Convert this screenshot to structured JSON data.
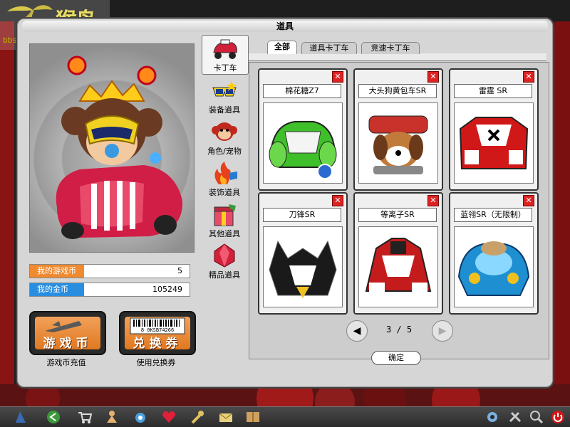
{
  "watermark": {
    "logo_text": "猴岛",
    "url": "bbs.houdao.com"
  },
  "window": {
    "title": "道具"
  },
  "categories": [
    {
      "label": "卡丁车",
      "icon": "kart-icon",
      "selected": true
    },
    {
      "label": "装备道具",
      "icon": "goggles-icon"
    },
    {
      "label": "角色/宠物",
      "icon": "monkey-icon"
    },
    {
      "label": "装饰道具",
      "icon": "flame-decor-icon"
    },
    {
      "label": "其他道具",
      "icon": "gift-box-icon"
    },
    {
      "label": "精品道具",
      "icon": "gem-icon"
    }
  ],
  "tabs": [
    {
      "label": "全部",
      "active": true
    },
    {
      "label": "道具卡丁车"
    },
    {
      "label": "竞速卡丁车"
    }
  ],
  "items": [
    {
      "name": "棉花糖Z7",
      "color": "#3fbf2a"
    },
    {
      "name": "大头狗黄包车SR",
      "color": "#c8322a"
    },
    {
      "name": "雷霆 SR",
      "color": "#d01818"
    },
    {
      "name": "刀锋SR",
      "color": "#1a1a1a"
    },
    {
      "name": "等离子SR",
      "color": "#c41c1c"
    },
    {
      "name": "蓝翎SR（无限制）",
      "color": "#1e8fd0"
    }
  ],
  "pager": {
    "text": "3 / 5"
  },
  "confirm_label": "确定",
  "stats": {
    "game_coin_label": "我的游戏币",
    "game_coin_value": "5",
    "gold_label": "我的金币",
    "gold_value": "105249"
  },
  "buttons": {
    "recharge_text": "游戏币",
    "recharge_caption": "游戏币充值",
    "voucher_text": "兑换券",
    "voucher_caption": "使用兑换券",
    "voucher_barcode": "8 0KSB74266"
  },
  "colors": {
    "game_coin_bar": "#f08a30",
    "gold_bar": "#2a8ee0"
  }
}
